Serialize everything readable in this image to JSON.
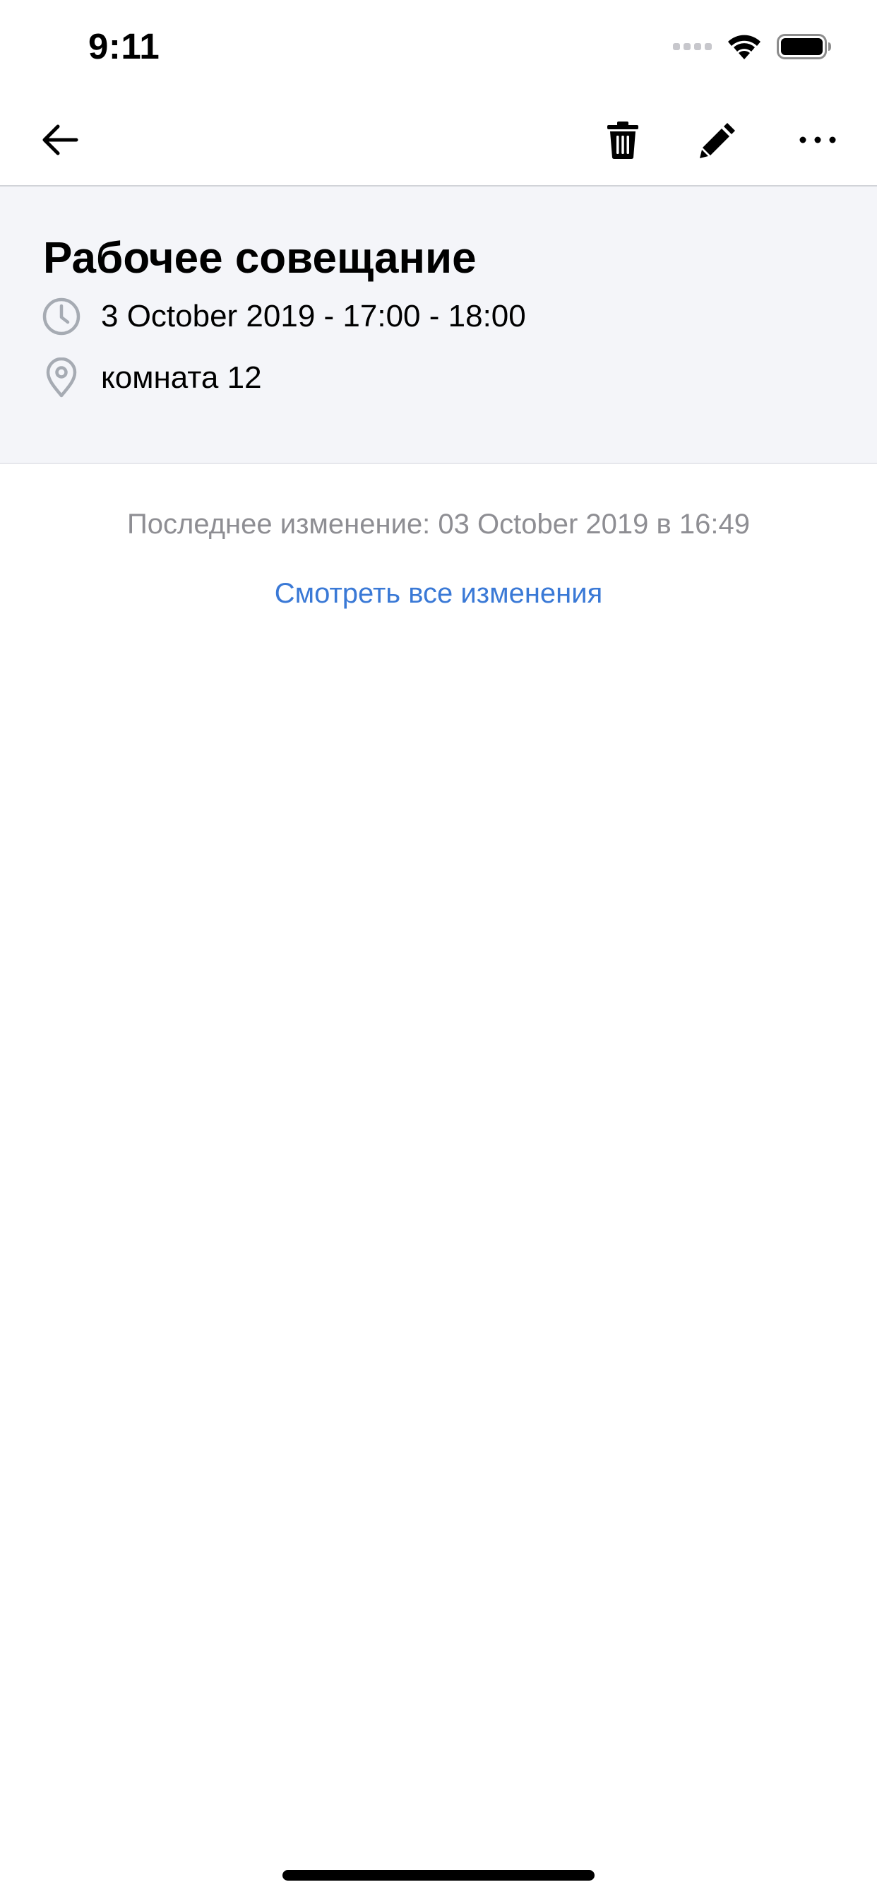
{
  "status_bar": {
    "time": "9:11",
    "icons": [
      "signal-dots-icon",
      "wifi-icon",
      "battery-icon"
    ]
  },
  "toolbar": {
    "back_icon": "arrow-left-icon",
    "delete_icon": "trash-icon",
    "edit_icon": "pencil-icon",
    "more_icon": "ellipsis-icon"
  },
  "event": {
    "title": "Рабочее совещание",
    "datetime": "3 October 2019 - 17:00 - 18:00",
    "location": "комната 12",
    "datetime_icon": "clock-icon",
    "location_icon": "location-pin-icon"
  },
  "changes": {
    "last_change": "Последнее изменение: 03 October 2019 в 16:49",
    "view_all_label": "Смотреть все изменения"
  },
  "colors": {
    "link": "#3a79d6",
    "header_bg": "#f4f5f9",
    "muted_text": "#8e8e93",
    "icon_gray": "#a6abb3"
  }
}
